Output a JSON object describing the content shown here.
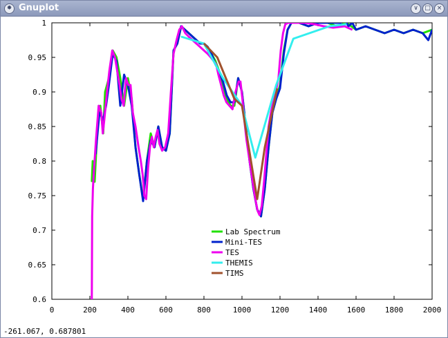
{
  "window": {
    "title": "Gnuplot",
    "icon": "gnuplot-app-icon",
    "controls": [
      {
        "name": "minimize-button",
        "glyph": "∨"
      },
      {
        "name": "maximize-button",
        "glyph": "□"
      },
      {
        "name": "close-button",
        "glyph": "×"
      }
    ]
  },
  "status_bar": {
    "coordinates": "-261.067,  0.687801"
  },
  "chart_data": {
    "type": "line",
    "title": "",
    "xlabel": "",
    "ylabel": "",
    "xlim": [
      0,
      2000
    ],
    "ylim": [
      0.6,
      1.0
    ],
    "x_ticks": [
      0,
      200,
      400,
      600,
      800,
      1000,
      1200,
      1400,
      1600,
      1800,
      2000
    ],
    "y_ticks": [
      0.6,
      0.65,
      0.7,
      0.75,
      0.8,
      0.85,
      0.9,
      0.95,
      1.0
    ],
    "x_tick_labels": [
      "0",
      "200",
      "400",
      "600",
      "800",
      "1000",
      "1200",
      "1400",
      "1600",
      "1800",
      "2000"
    ],
    "y_tick_labels": [
      "0.6",
      "0.65",
      "0.7",
      "0.75",
      "0.8",
      "0.85",
      "0.9",
      "0.95",
      "1"
    ],
    "grid": false,
    "legend_position": "bottom-center",
    "series": [
      {
        "name": "Lab Spectrum",
        "color": "#22e000",
        "width": 3,
        "x": [
          210,
          215,
          225,
          240,
          255,
          270,
          280,
          300,
          320,
          340,
          360,
          380,
          400,
          420,
          440,
          460,
          480,
          500,
          520,
          540,
          560,
          580,
          600,
          620,
          640,
          660,
          680,
          700,
          720,
          740,
          760,
          780,
          800,
          820,
          840,
          860,
          880,
          900,
          920,
          940,
          960,
          980,
          1000,
          1020,
          1040,
          1060,
          1080,
          1100,
          1120,
          1140,
          1160,
          1180,
          1200,
          1220,
          1240,
          1260,
          1300,
          1350,
          1400,
          1450,
          1500,
          1550,
          1600,
          1650,
          1700,
          1750,
          1800,
          1850,
          1900,
          1950,
          2000
        ],
        "y": [
          0.77,
          0.8,
          0.77,
          0.85,
          0.88,
          0.84,
          0.9,
          0.92,
          0.96,
          0.95,
          0.92,
          0.88,
          0.92,
          0.89,
          0.82,
          0.78,
          0.745,
          0.8,
          0.84,
          0.82,
          0.85,
          0.82,
          0.815,
          0.84,
          0.96,
          0.97,
          0.995,
          0.99,
          0.985,
          0.98,
          0.975,
          0.97,
          0.97,
          0.965,
          0.955,
          0.945,
          0.93,
          0.91,
          0.89,
          0.88,
          0.88,
          0.92,
          0.9,
          0.85,
          0.8,
          0.76,
          0.73,
          0.72,
          0.76,
          0.82,
          0.87,
          0.89,
          0.91,
          0.96,
          0.99,
          1.0,
          1.0,
          0.995,
          1.0,
          1.0,
          0.995,
          1.0,
          0.99,
          0.995,
          0.99,
          0.985,
          0.99,
          0.985,
          0.99,
          0.985,
          0.99
        ]
      },
      {
        "name": "Mini-TES",
        "color": "#0022cc",
        "width": 3,
        "x": [
          230,
          250,
          270,
          285,
          300,
          320,
          340,
          360,
          380,
          400,
          420,
          440,
          460,
          480,
          500,
          520,
          540,
          560,
          580,
          600,
          620,
          640,
          660,
          680,
          700,
          720,
          740,
          760,
          780,
          800,
          820,
          840,
          860,
          880,
          900,
          920,
          940,
          960,
          980,
          1000,
          1020,
          1040,
          1060,
          1080,
          1100,
          1120,
          1140,
          1160,
          1180,
          1200,
          1220,
          1240,
          1260,
          1300,
          1350,
          1400,
          1450,
          1500,
          1520,
          1540,
          1560,
          1580,
          1600,
          1650,
          1700,
          1750,
          1800,
          1850,
          1900,
          1950,
          1980,
          2000
        ],
        "y": [
          0.81,
          0.87,
          0.86,
          0.88,
          0.91,
          0.955,
          0.945,
          0.88,
          0.925,
          0.91,
          0.88,
          0.82,
          0.78,
          0.742,
          0.8,
          0.83,
          0.82,
          0.85,
          0.82,
          0.815,
          0.84,
          0.96,
          0.97,
          0.995,
          0.99,
          0.985,
          0.98,
          0.975,
          0.97,
          0.97,
          0.965,
          0.955,
          0.94,
          0.93,
          0.915,
          0.895,
          0.885,
          0.885,
          0.92,
          0.9,
          0.85,
          0.8,
          0.76,
          0.73,
          0.72,
          0.76,
          0.82,
          0.87,
          0.89,
          0.905,
          0.955,
          0.99,
          1.0,
          1.0,
          0.995,
          1.0,
          1.0,
          1.0,
          1.0,
          1.005,
          0.995,
          1.0,
          0.99,
          0.995,
          0.99,
          0.985,
          0.99,
          0.985,
          0.99,
          0.985,
          0.975,
          0.99
        ]
      },
      {
        "name": "TES",
        "color": "#ee00ee",
        "width": 3,
        "x": [
          210,
          212,
          216,
          220,
          232,
          246,
          260,
          268,
          276,
          290,
          302,
          318,
          332,
          344,
          356,
          366,
          378,
          390,
          402,
          414,
          426,
          440,
          456,
          468,
          478,
          486,
          496,
          506,
          516,
          526,
          536,
          546,
          556,
          566,
          580,
          596,
          612,
          626,
          640,
          656,
          670,
          684,
          702,
          720,
          740,
          760,
          780,
          800,
          820,
          836,
          850,
          864,
          876,
          890,
          904,
          918,
          934,
          950,
          966,
          982,
          992,
          1002,
          1012,
          1024,
          1040,
          1056,
          1070,
          1082,
          1092,
          1104,
          1116,
          1128,
          1140,
          1152,
          1164,
          1178,
          1192,
          1204,
          1216,
          1228,
          1242,
          1260,
          1290,
          1330,
          1380,
          1430,
          1480,
          1540,
          1580
        ],
        "y": [
          0.6,
          0.72,
          0.76,
          0.78,
          0.83,
          0.88,
          0.87,
          0.84,
          0.86,
          0.9,
          0.93,
          0.96,
          0.95,
          0.93,
          0.91,
          0.89,
          0.88,
          0.92,
          0.91,
          0.91,
          0.87,
          0.85,
          0.82,
          0.8,
          0.78,
          0.75,
          0.745,
          0.79,
          0.82,
          0.835,
          0.82,
          0.835,
          0.845,
          0.825,
          0.815,
          0.82,
          0.84,
          0.9,
          0.955,
          0.975,
          0.99,
          0.995,
          0.985,
          0.98,
          0.975,
          0.97,
          0.965,
          0.96,
          0.955,
          0.95,
          0.945,
          0.94,
          0.925,
          0.91,
          0.895,
          0.885,
          0.88,
          0.875,
          0.9,
          0.915,
          0.915,
          0.89,
          0.86,
          0.83,
          0.8,
          0.77,
          0.745,
          0.728,
          0.722,
          0.735,
          0.77,
          0.81,
          0.85,
          0.87,
          0.885,
          0.9,
          0.92,
          0.96,
          0.985,
          0.998,
          1.0,
          1.0,
          1.0,
          1.0,
          0.998,
          0.995,
          0.993,
          0.995,
          0.99
        ]
      },
      {
        "name": "THEMIS",
        "color": "#33eeee",
        "width": 3,
        "x": [
          680,
          800,
          900,
          1000,
          1070,
          1180,
          1270,
          1460,
          1550
        ],
        "y": [
          0.98,
          0.97,
          0.92,
          0.88,
          0.805,
          0.91,
          0.977,
          0.995,
          0.998
        ]
      },
      {
        "name": "TIMS",
        "color": "#a0522d",
        "width": 3,
        "x": [
          800,
          870,
          960,
          1000,
          1080,
          1120,
          1185
        ],
        "y": [
          0.97,
          0.95,
          0.89,
          0.88,
          0.745,
          0.82,
          0.905
        ]
      }
    ]
  }
}
